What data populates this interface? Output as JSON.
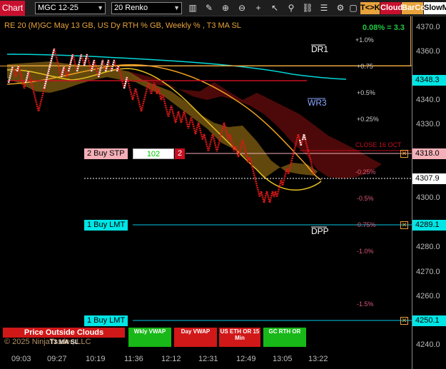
{
  "toolbar": {
    "chart_label": "Chart",
    "instrument": "MGC 12-25",
    "bar_type": "20 Renko",
    "icons": [
      "bars-icon",
      "draw-icon",
      "zoom-in-icon",
      "zoom-out-icon",
      "crosshair-icon",
      "pointer-icon",
      "strategy-icon",
      "link-icon",
      "properties-icon"
    ],
    "tk_label": "T<>K",
    "cloud_label": "Cloud",
    "barcol_label": "BarCol",
    "slowm_label": "SlowM"
  },
  "chart": {
    "title": "RE 20  (M)GC May 13 GB, US Dy RTH % GB, Weekly % , T3 MA SL",
    "pct_change": "0.08% = 3.3",
    "copyright": "© 2025 NinjaTrader, LLC",
    "price_ticks": [
      "4370.0",
      "4360.0",
      "4340.0",
      "4330.0",
      "4300.0",
      "4280.0",
      "4270.0",
      "4260.0",
      "4240.0"
    ],
    "time_ticks": [
      "09:03",
      "09:27",
      "10:19",
      "11:36",
      "12:12",
      "12:31",
      "12:49",
      "13:05",
      "13:22"
    ],
    "price_tags": {
      "tag1": "4348.3",
      "tag2": "4318.0",
      "tag3": "4307.9",
      "tag4": "4289.1",
      "tag5": "4250.1"
    },
    "percent_levels": [
      "+1.0%",
      "+0.75",
      "+0.5%",
      "+0.25%",
      "-0.25%",
      "-0.5%",
      "-0.75%",
      "-1.0%",
      "-1.5%"
    ],
    "level_marks": {
      "dr1": "DR1",
      "wr3": "WR3",
      "dpp": "DPP",
      "close": "CLOSE 16 OCT"
    },
    "orders": {
      "stop": {
        "label": "2 Buy STP",
        "qty": "102",
        "count": "2"
      },
      "lmt1": {
        "label": "1 Buy LMT"
      },
      "lmt2": {
        "label": "1 Buy LMT"
      }
    },
    "indicators": {
      "price_clouds": "Price Outside Clouds",
      "t3": "T3 MA SL",
      "wkly_vwap": "Wkly VWAP",
      "day_vwap": "Day VWAP",
      "us_eth": "US ETH OR 15 Min",
      "gc_rth": "GC RTH OR"
    }
  },
  "colors": {
    "accent_orange": "#e8a33c",
    "cloud_red": "#6e0b0b",
    "cloud_gold": "#8a6a10",
    "cyan": "#00e5e5",
    "stop_pink": "#f4b0b8",
    "indicator_green": "#18b818",
    "indicator_red": "#d01818"
  }
}
